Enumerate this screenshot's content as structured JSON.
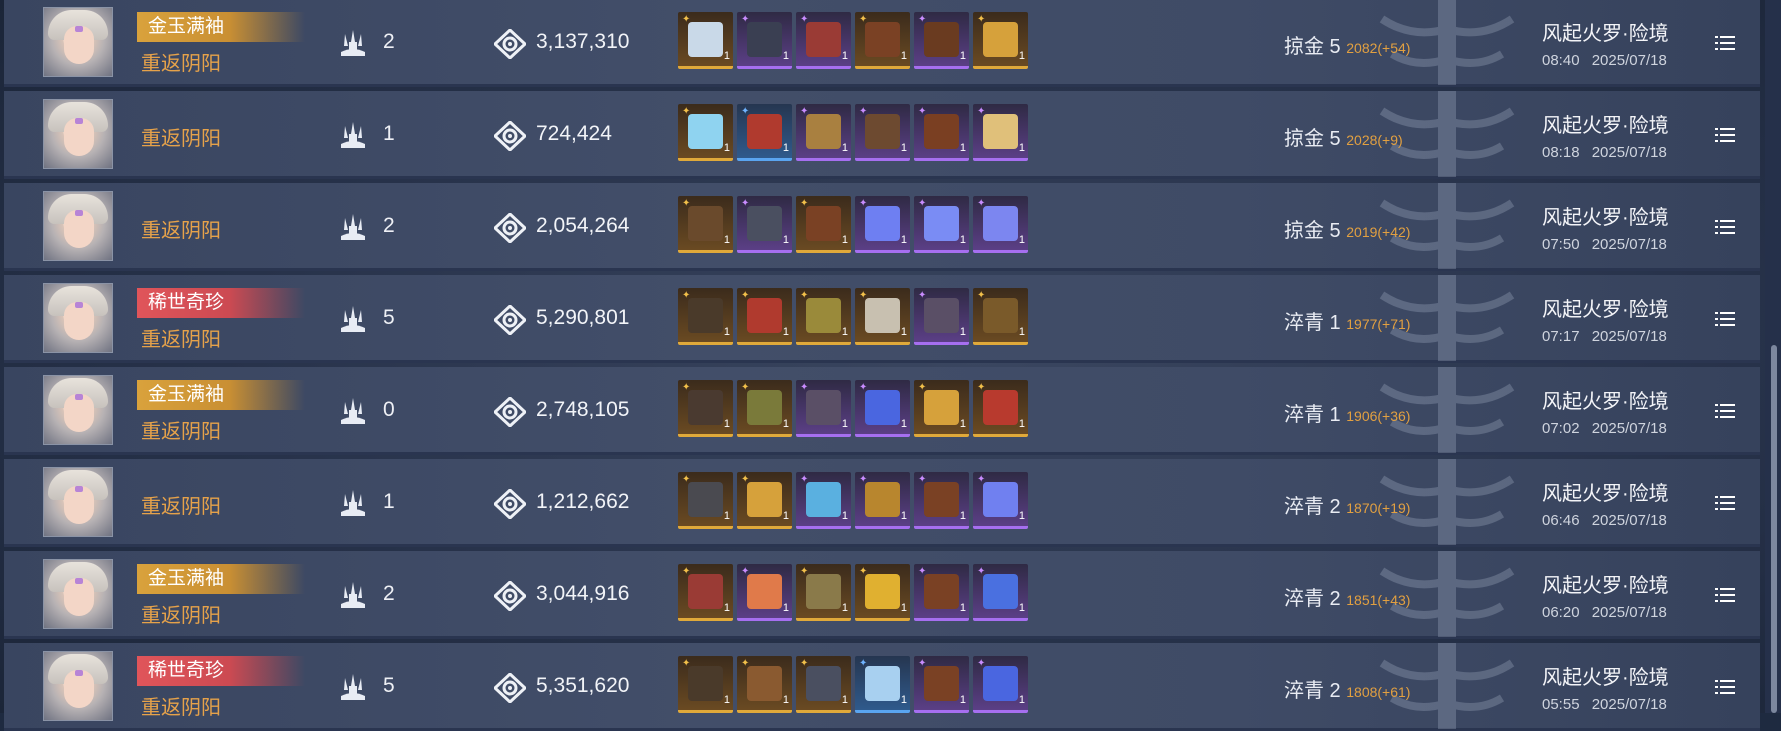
{
  "rows": [
    {
      "badge": "金玉满袖",
      "badge_type": "gold",
      "mode": "重返阴阳",
      "kills": "2",
      "score": "3,137,310",
      "rank": "掠金 5",
      "points": "2082(+54)",
      "location": "风起火罗·险境",
      "time": "08:40",
      "date": "2025/07/18",
      "items": [
        {
          "q": "gold",
          "art": "#c9d9e8"
        },
        {
          "q": "purp",
          "art": "#3a3f52"
        },
        {
          "q": "purp",
          "art": "#9a3b35"
        },
        {
          "q": "gold",
          "art": "#7a4124"
        },
        {
          "q": "purp",
          "art": "#6a3b20"
        },
        {
          "q": "gold",
          "art": "#d6a13b"
        }
      ]
    },
    {
      "badge": "",
      "badge_type": "",
      "mode": "重返阴阳",
      "kills": "1",
      "score": "724,424",
      "rank": "掠金 5",
      "points": "2028(+9)",
      "location": "风起火罗·险境",
      "time": "08:18",
      "date": "2025/07/18",
      "items": [
        {
          "q": "gold",
          "art": "#8fd3f0"
        },
        {
          "q": "blue",
          "art": "#b03a2e"
        },
        {
          "q": "purp",
          "art": "#a98040"
        },
        {
          "q": "purp",
          "art": "#6d4a30"
        },
        {
          "q": "purp",
          "art": "#7a3f22"
        },
        {
          "q": "purp",
          "art": "#e0c07a"
        }
      ]
    },
    {
      "badge": "",
      "badge_type": "",
      "mode": "重返阴阳",
      "kills": "2",
      "score": "2,054,264",
      "rank": "掠金 5",
      "points": "2019(+42)",
      "location": "风起火罗·险境",
      "time": "07:50",
      "date": "2025/07/18",
      "items": [
        {
          "q": "gold",
          "art": "#6a4a2c"
        },
        {
          "q": "purp",
          "art": "#4a4f60"
        },
        {
          "q": "gold",
          "art": "#7a4124"
        },
        {
          "q": "purp",
          "art": "#6e7ff2"
        },
        {
          "q": "purp",
          "art": "#7a8cf4"
        },
        {
          "q": "purp",
          "art": "#7c86f0"
        }
      ]
    },
    {
      "badge": "稀世奇珍",
      "badge_type": "red",
      "mode": "重返阴阳",
      "kills": "5",
      "score": "5,290,801",
      "rank": "淬青 1",
      "points": "1977(+71)",
      "location": "风起火罗·险境",
      "time": "07:17",
      "date": "2025/07/18",
      "items": [
        {
          "q": "gold",
          "art": "#4a3a2a"
        },
        {
          "q": "gold",
          "art": "#b03a2e"
        },
        {
          "q": "gold",
          "art": "#9a8a3a"
        },
        {
          "q": "gold",
          "art": "#c8c0b0"
        },
        {
          "q": "purp",
          "art": "#5a4f66"
        },
        {
          "q": "gold",
          "art": "#7a5a2a"
        }
      ]
    },
    {
      "badge": "金玉满袖",
      "badge_type": "gold",
      "mode": "重返阴阳",
      "kills": "0",
      "score": "2,748,105",
      "rank": "淬青 1",
      "points": "1906(+36)",
      "location": "风起火罗·险境",
      "time": "07:02",
      "date": "2025/07/18",
      "items": [
        {
          "q": "gold",
          "art": "#4a3a30"
        },
        {
          "q": "gold",
          "art": "#7a7a3a"
        },
        {
          "q": "purp",
          "art": "#5a4f66"
        },
        {
          "q": "purp",
          "art": "#4a66e0"
        },
        {
          "q": "gold",
          "art": "#d6a13b"
        },
        {
          "q": "gold",
          "art": "#b83a2e"
        }
      ]
    },
    {
      "badge": "",
      "badge_type": "",
      "mode": "重返阴阳",
      "kills": "1",
      "score": "1,212,662",
      "rank": "淬青 2",
      "points": "1870(+19)",
      "location": "风起火罗·险境",
      "time": "06:46",
      "date": "2025/07/18",
      "items": [
        {
          "q": "gold",
          "art": "#4a4a50"
        },
        {
          "q": "gold",
          "art": "#d6a13b"
        },
        {
          "q": "purp",
          "art": "#5ab0e0"
        },
        {
          "q": "purp",
          "art": "#b8862e"
        },
        {
          "q": "purp",
          "art": "#7a4124"
        },
        {
          "q": "purp",
          "art": "#7080f0"
        }
      ]
    },
    {
      "badge": "金玉满袖",
      "badge_type": "gold",
      "mode": "重返阴阳",
      "kills": "2",
      "score": "3,044,916",
      "rank": "淬青 2",
      "points": "1851(+43)",
      "location": "风起火罗·险境",
      "time": "06:20",
      "date": "2025/07/18",
      "items": [
        {
          "q": "gold",
          "art": "#9a3b35"
        },
        {
          "q": "purp",
          "art": "#e07a4a"
        },
        {
          "q": "gold",
          "art": "#8a7a4a"
        },
        {
          "q": "gold",
          "art": "#e0b030"
        },
        {
          "q": "purp",
          "art": "#7a4124"
        },
        {
          "q": "purp",
          "art": "#4a70e0"
        }
      ]
    },
    {
      "badge": "稀世奇珍",
      "badge_type": "red",
      "mode": "重返阴阳",
      "kills": "5",
      "score": "5,351,620",
      "rank": "淬青 2",
      "points": "1808(+61)",
      "location": "风起火罗·险境",
      "time": "05:55",
      "date": "2025/07/18",
      "items": [
        {
          "q": "gold",
          "art": "#4a3a2a"
        },
        {
          "q": "gold",
          "art": "#8a5a30"
        },
        {
          "q": "gold",
          "art": "#4a4f60"
        },
        {
          "q": "blue",
          "art": "#a8d0f0"
        },
        {
          "q": "purp",
          "art": "#7a4124"
        },
        {
          "q": "purp",
          "art": "#4a66e0"
        }
      ]
    }
  ],
  "item_count": "1"
}
